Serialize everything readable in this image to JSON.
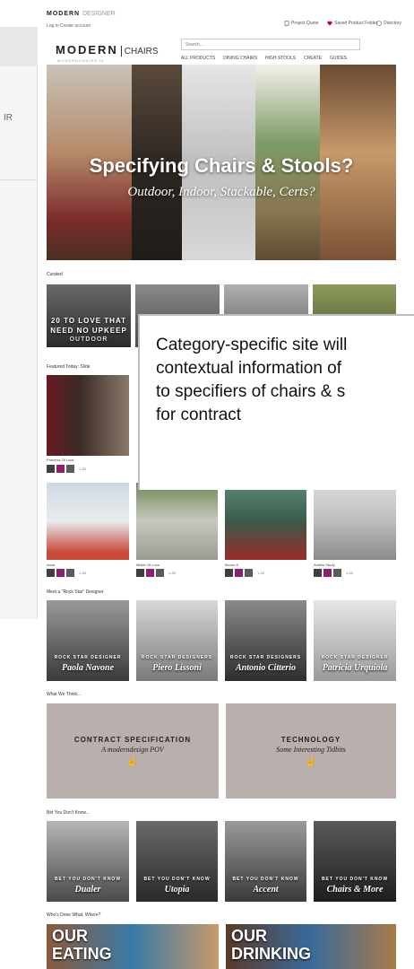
{
  "left_fragment": "IR",
  "topbar": {
    "logo_main": "MODERN",
    "logo_tag": "DESIGNER",
    "login": "Log in   Create account",
    "project_quote": "Project Quote",
    "saved_products": "Saved Product Folder",
    "directory": "Directory"
  },
  "header": {
    "logo_left": "MODERN",
    "logo_right": "CHAIRS",
    "logo_sub": "MODERNCHAIRS.IE",
    "search_placeholder": "Search...",
    "nav": [
      "ALL PRODUCTS",
      "DINING CHAIRS",
      "HIGH STOOLS",
      "CREATE",
      "GUIDES"
    ]
  },
  "hero": {
    "title": "Specifying Chairs & Stools?",
    "subtitle": "Outdoor, Indoor, Stackable, Certs?"
  },
  "sections": {
    "curated": "Curated",
    "featured": "Featured Today: Slide",
    "rock_star": "Meet a \"Rock Star\" Designer",
    "what_we_think": "What We Think...",
    "bet": "Bet You Don't Know...",
    "who": "Who's Done What, Where?"
  },
  "curated_tile_text": [
    "20 TO LOVE THAT",
    "NEED NO UPKEEP",
    "OUTDOOR"
  ],
  "callout_text": "Category-specific site will\ncontextual information of\nto specifiers of chairs & s\nfor contract",
  "featured_product": {
    "name": "Princess Of Love",
    "count": "1-30"
  },
  "products": [
    {
      "name": "Anna",
      "count": "1-30"
    },
    {
      "name": "Mister Of Love",
      "count": "1-30"
    },
    {
      "name": "Bloom 8",
      "count": "1-30"
    },
    {
      "name": "Amelia Study",
      "count": "1-30"
    }
  ],
  "swatch_colors": [
    "#3f3f3f",
    "#8d1f6e",
    "#5b5b5b"
  ],
  "designers": [
    {
      "tag": "ROCK STAR DESIGNER",
      "name": "Paola Navone"
    },
    {
      "tag": "ROCK STAR DESIGNERS",
      "name": "Piero Lissoni"
    },
    {
      "tag": "ROCK STAR DESIGNERS",
      "name": "Antonio Citterio"
    },
    {
      "tag": "ROCK STAR DESIGNER",
      "name": "Patricia Urquiola"
    }
  ],
  "think_cards": [
    {
      "title": "CONTRACT SPECIFICATION",
      "subtitle": "A moderndesign POV"
    },
    {
      "title": "TECHNOLOGY",
      "subtitle": "Some Interesting Tidbits"
    }
  ],
  "bet_tiles": [
    {
      "tag": "BET YOU DON'T KNOW",
      "name": "Dualer"
    },
    {
      "tag": "BET YOU DON'T KNOW",
      "name": "Utopia"
    },
    {
      "tag": "BET YOU DON'T KNOW",
      "name": "Accent"
    },
    {
      "tag": "BET YOU DON'T KNOW",
      "name": "Chairs & More"
    }
  ],
  "who_tiles": [
    {
      "l1": "OUR",
      "l2": "EATING"
    },
    {
      "l1": "OUR",
      "l2": "DRINKING"
    }
  ],
  "colors": {
    "accent": "#8d1f6e",
    "card_gray": "#b9afad",
    "heart": "#d0021b"
  }
}
